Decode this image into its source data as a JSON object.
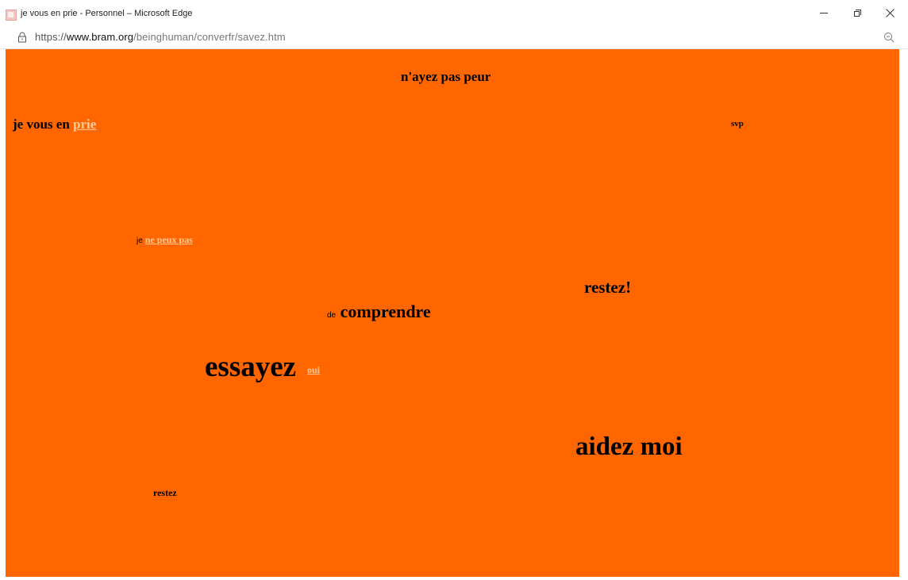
{
  "window": {
    "title": "je vous en prie - Personnel – Microsoft Edge",
    "favicon": "page-favicon"
  },
  "address_bar": {
    "url_scheme": "https://",
    "url_host": "www.bram.org",
    "url_path": "/beinghuman/converfr/savez.htm",
    "lock_icon": "lock-icon",
    "zoom_icon": "zoom-out-icon"
  },
  "colors": {
    "page_background": "#ff6600",
    "link": "#ffcc99",
    "text": "#000000"
  },
  "page": {
    "nayez": "n'ayez pas peur",
    "jevousen": "je vous en",
    "prie": "prie",
    "svp": "svp",
    "je": "je",
    "nepeuxpas": "ne peux pas",
    "restez_bang": "restez!",
    "de": "de",
    "comprendre": "comprendre",
    "essayez": "essayez",
    "oui": "oui",
    "aidezmoi": "aidez moi",
    "restez": "restez"
  }
}
